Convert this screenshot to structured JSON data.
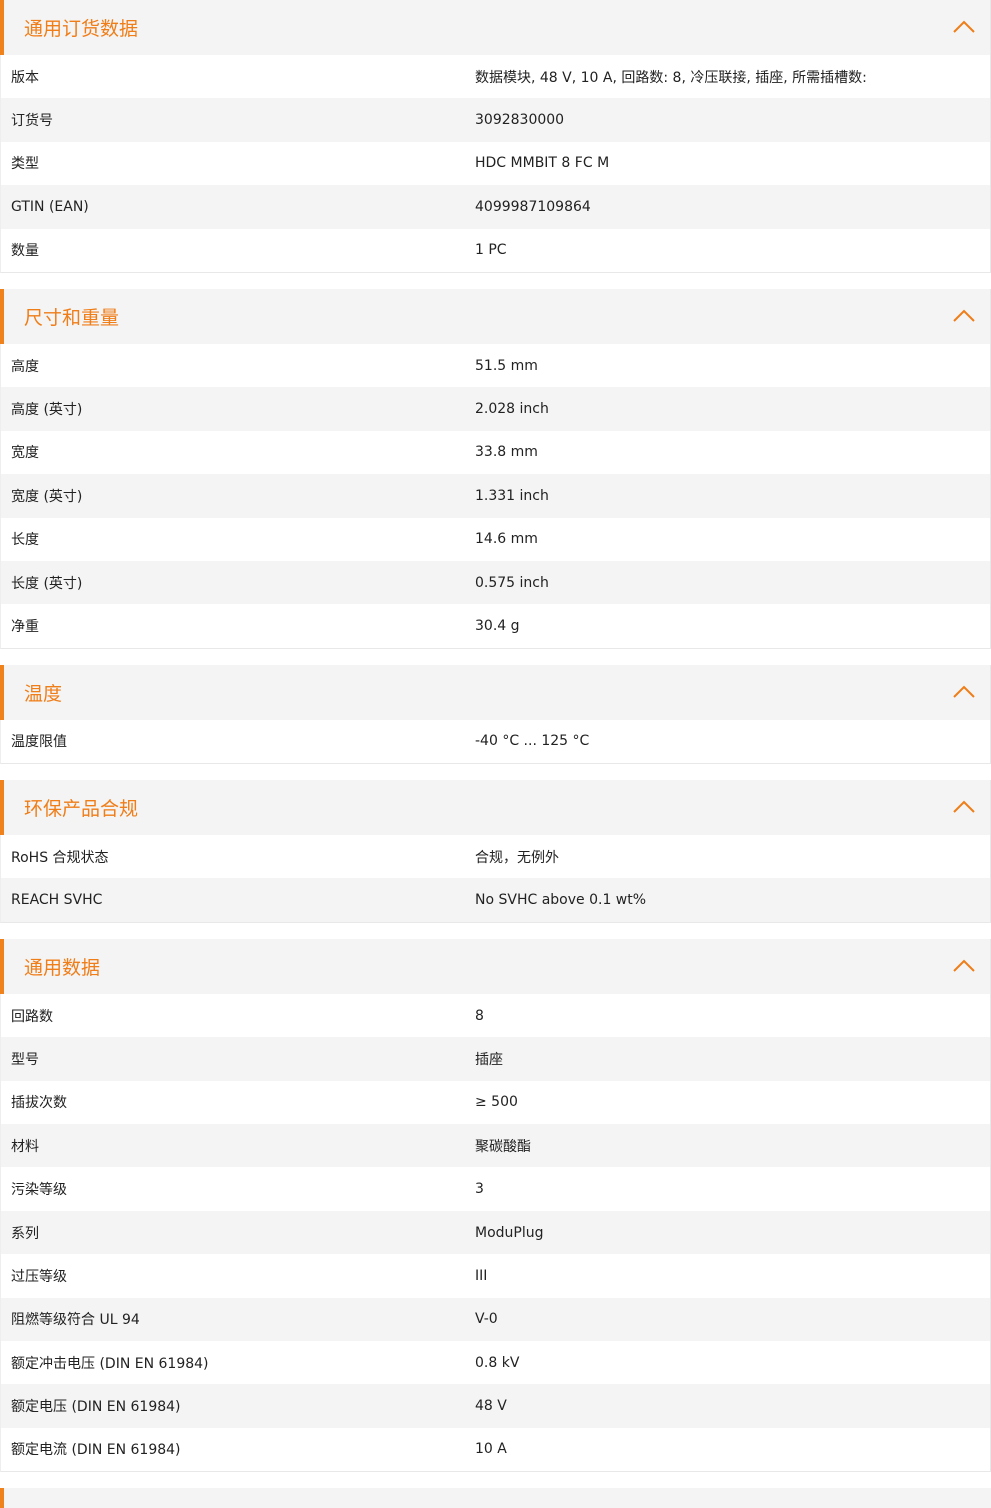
{
  "sections": [
    {
      "title": "通用订货数据",
      "rows": [
        {
          "label": "版本",
          "value": "数据模块, 48 V, 10 A, 回路数: 8, 冷压联接, 插座, 所需插槽数:"
        },
        {
          "label": "订货号",
          "value": "3092830000"
        },
        {
          "label": "类型",
          "value": "HDC MMBIT 8 FC M"
        },
        {
          "label": "GTIN (EAN)",
          "value": "4099987109864"
        },
        {
          "label": "数量",
          "value": "1  PC"
        }
      ]
    },
    {
      "title": "尺寸和重量",
      "rows": [
        {
          "label": "高度",
          "value": "51.5  mm"
        },
        {
          "label": "高度 (英寸)",
          "value": "2.028  inch"
        },
        {
          "label": "宽度",
          "value": "33.8  mm"
        },
        {
          "label": "宽度 (英寸)",
          "value": "1.331  inch"
        },
        {
          "label": "长度",
          "value": "14.6  mm"
        },
        {
          "label": "长度 (英寸)",
          "value": "0.575  inch"
        },
        {
          "label": "净重",
          "value": "30.4  g"
        }
      ]
    },
    {
      "title": "温度",
      "rows": [
        {
          "label": "温度限值",
          "value": "-40 °C ... 125 °C"
        }
      ]
    },
    {
      "title": "环保产品合规",
      "rows": [
        {
          "label": "RoHS 合规状态",
          "value": "合规，无例外"
        },
        {
          "label": "REACH SVHC",
          "value": "No SVHC above 0.1 wt%"
        }
      ]
    },
    {
      "title": "通用数据",
      "rows": [
        {
          "label": "回路数",
          "value": "8"
        },
        {
          "label": "型号",
          "value": "插座"
        },
        {
          "label": "插拔次数",
          "value": "≥ 500"
        },
        {
          "label": "材料",
          "value": "聚碳酸酯"
        },
        {
          "label": "污染等级",
          "value": "3"
        },
        {
          "label": "系列",
          "value": "ModuPlug"
        },
        {
          "label": "过压等级",
          "value": "III"
        },
        {
          "label": "阻燃等级符合 UL 94",
          "value": "V-0"
        },
        {
          "label": "额定冲击电压 (DIN EN 61984)",
          "value": "0.8  kV"
        },
        {
          "label": "额定电压 (DIN EN 61984)",
          "value": "48  V"
        },
        {
          "label": "额定电流 (DIN EN 61984)",
          "value": "10  A"
        }
      ]
    }
  ],
  "icons": {
    "collapse": "chevron-up-icon"
  },
  "colors": {
    "accent": "#ef7d18",
    "stripe": "#f4f4f4"
  }
}
